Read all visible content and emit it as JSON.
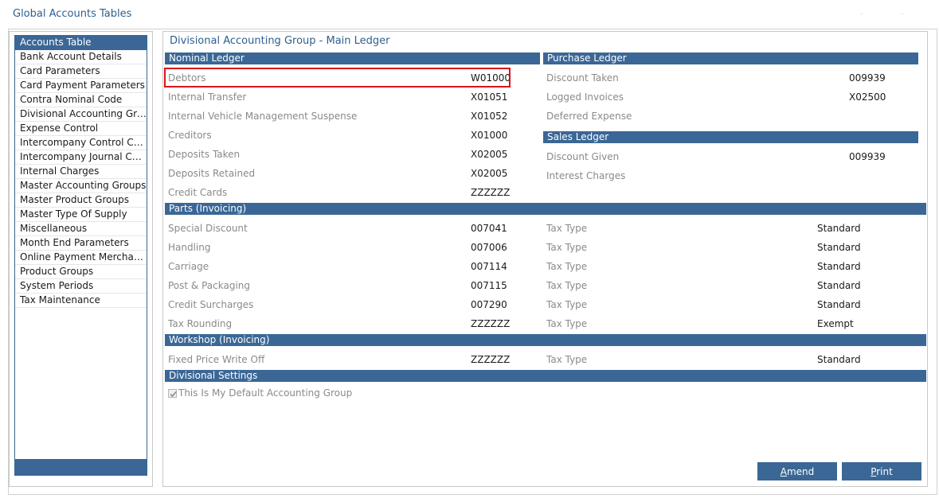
{
  "window": {
    "title": "Global Accounts Tables",
    "controls": "‐ ‐"
  },
  "nav": {
    "items": [
      {
        "label": "Accounts Table"
      },
      {
        "label": "Bank Account Details"
      },
      {
        "label": "Card Parameters"
      },
      {
        "label": "Card Payment Parameters"
      },
      {
        "label": "Contra Nominal Code"
      },
      {
        "label": "Divisional Accounting Grou..."
      },
      {
        "label": "Expense Control"
      },
      {
        "label": "Intercompany Control Codes"
      },
      {
        "label": "Intercompany Journal Codes"
      },
      {
        "label": "Internal Charges"
      },
      {
        "label": "Master Accounting Groups"
      },
      {
        "label": "Master Product Groups"
      },
      {
        "label": "Master Type Of Supply"
      },
      {
        "label": "Miscellaneous"
      },
      {
        "label": "Month End Parameters"
      },
      {
        "label": "Online Payment Merchants"
      },
      {
        "label": "Product Groups"
      },
      {
        "label": "System Periods"
      },
      {
        "label": "Tax Maintenance"
      }
    ],
    "active_index": 0
  },
  "main": {
    "title": "Divisional Accounting Group - Main Ledger",
    "nominal": {
      "header": "Nominal Ledger",
      "rows": [
        {
          "label": "Debtors",
          "value": "W01000"
        },
        {
          "label": "Internal Transfer",
          "value": "X01051"
        },
        {
          "label": "Internal Vehicle Management Suspense",
          "value": "X01052"
        },
        {
          "label": "Creditors",
          "value": "X01000"
        },
        {
          "label": "Deposits Taken",
          "value": "X02005"
        },
        {
          "label": "Deposits Retained",
          "value": "X02005"
        },
        {
          "label": "Credit Cards",
          "value": "ZZZZZZ"
        }
      ]
    },
    "purchase": {
      "header": "Purchase Ledger",
      "rows": [
        {
          "label": "Discount Taken",
          "value": "009939"
        },
        {
          "label": "Logged Invoices",
          "value": "X02500"
        },
        {
          "label": "Deferred Expense",
          "value": ""
        }
      ]
    },
    "sales": {
      "header": "Sales Ledger",
      "rows": [
        {
          "label": "Discount Given",
          "value": "009939"
        },
        {
          "label": "Interest Charges",
          "value": ""
        }
      ]
    },
    "parts": {
      "header": "Parts (Invoicing)",
      "rows": [
        {
          "label": "Special Discount",
          "value": "007041",
          "tax_label": "Tax Type",
          "tax_value": "Standard"
        },
        {
          "label": "Handling",
          "value": "007006",
          "tax_label": "Tax Type",
          "tax_value": "Standard"
        },
        {
          "label": "Carriage",
          "value": "007114",
          "tax_label": "Tax Type",
          "tax_value": "Standard"
        },
        {
          "label": "Post & Packaging",
          "value": "007115",
          "tax_label": "Tax Type",
          "tax_value": "Standard"
        },
        {
          "label": "Credit Surcharges",
          "value": "007290",
          "tax_label": "Tax Type",
          "tax_value": "Standard"
        },
        {
          "label": "Tax Rounding",
          "value": "ZZZZZZ",
          "tax_label": "Tax Type",
          "tax_value": "Exempt"
        }
      ]
    },
    "workshop": {
      "header": "Workshop (Invoicing)",
      "rows": [
        {
          "label": "Fixed Price Write Off",
          "value": "ZZZZZZ",
          "tax_label": "Tax Type",
          "tax_value": "Standard"
        }
      ]
    },
    "divisional": {
      "header": "Divisional Settings",
      "default_group_label": "This Is My Default Accounting Group",
      "default_group_checked": true
    }
  },
  "buttons": {
    "amend": "Amend",
    "print": "Print"
  },
  "colors": {
    "accent": "#3a6796",
    "title": "#2e5f8e",
    "highlight": "#d9141b"
  }
}
